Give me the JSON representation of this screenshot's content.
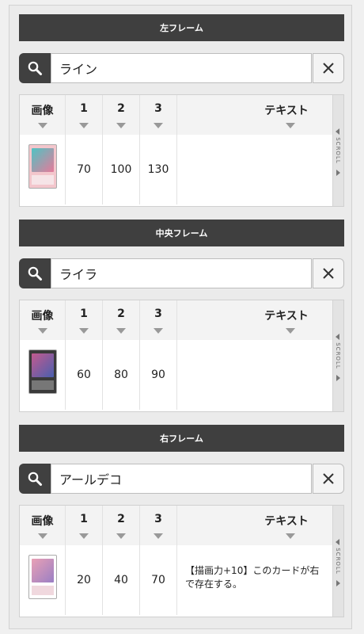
{
  "sections": [
    {
      "header": "左フレーム",
      "search": {
        "value": "ライン",
        "placeholder": ""
      },
      "columns": [
        "画像",
        "1",
        "2",
        "3",
        "テキスト"
      ],
      "row": {
        "v1": "70",
        "v2": "100",
        "v3": "130",
        "text": ""
      },
      "card_colors": {
        "frame": "#f3c6cc",
        "art": "#4fc3c3",
        "footer": "#f6e4e7"
      }
    },
    {
      "header": "中央フレーム",
      "search": {
        "value": "ライラ",
        "placeholder": ""
      },
      "columns": [
        "画像",
        "1",
        "2",
        "3",
        "テキスト"
      ],
      "row": {
        "v1": "60",
        "v2": "80",
        "v3": "90",
        "text": ""
      },
      "card_colors": {
        "frame": "#3a3a3a",
        "art": "#c35a8e",
        "footer": "#777777"
      }
    },
    {
      "header": "右フレーム",
      "search": {
        "value": "アールデコ",
        "placeholder": ""
      },
      "columns": [
        "画像",
        "1",
        "2",
        "3",
        "テキスト"
      ],
      "row": {
        "v1": "20",
        "v2": "40",
        "v3": "70",
        "text": "【描画力+10】このカードが右で存在する。"
      },
      "card_colors": {
        "frame": "#ffffff",
        "art": "#e9a0b5",
        "footer": "#f0d8de"
      }
    }
  ],
  "scroll_label": "SCROLL",
  "icons": {
    "search": "search-icon",
    "clear": "close-icon",
    "sort": "sort-arrow-icon"
  }
}
